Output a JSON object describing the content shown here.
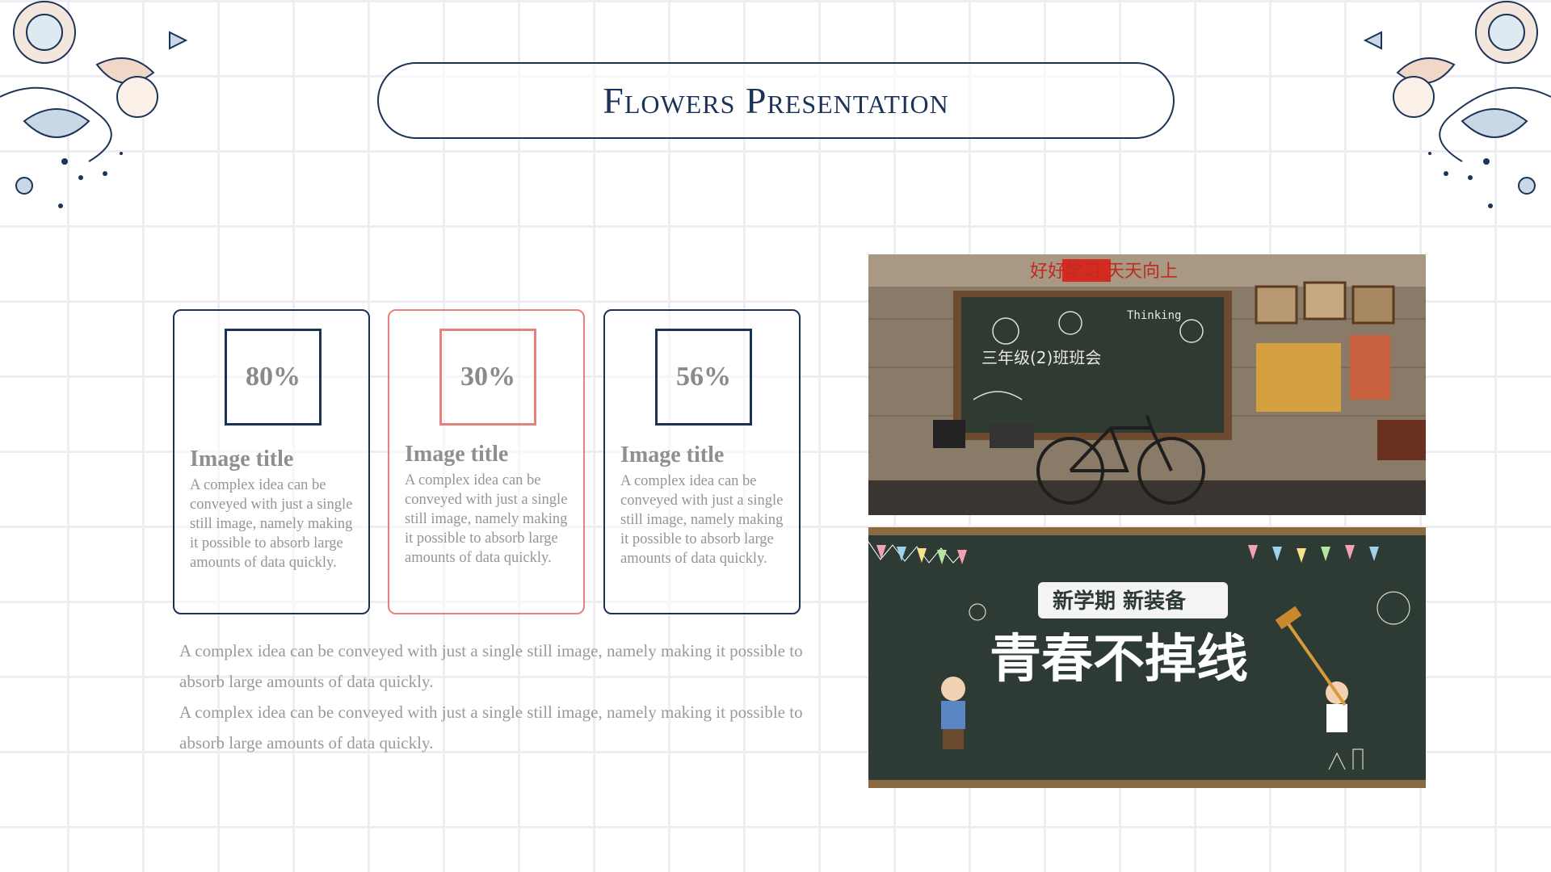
{
  "header": {
    "title": "Flowers Presentation"
  },
  "cards": [
    {
      "percent": "80%",
      "title": "Image title",
      "text": "A complex idea can be conveyed with just a single still image, namely making it possible to absorb large amounts of data quickly.",
      "accent": "#1c3358"
    },
    {
      "percent": "30%",
      "title": "Image title",
      "text": "A complex idea can be conveyed with just a single still image, namely making it possible to absorb large amounts of data quickly.",
      "accent": "#e8807e"
    },
    {
      "percent": "56%",
      "title": "Image title",
      "text": "A complex idea can be conveyed with just a single still image, namely making it possible to absorb large amounts of data quickly.",
      "accent": "#1c3358"
    }
  ],
  "paragraphs": [
    "A complex idea can be conveyed with just a single still image, namely making it possible to absorb large amounts of data quickly.",
    "A complex idea can be conveyed with just a single still image, namely making it possible to absorb large amounts of data quickly."
  ],
  "photos": {
    "top": {
      "banner_text": "好好学习 天天向上",
      "board_text": "三年级(2)班班会",
      "board_note": "Thinking"
    },
    "bottom": {
      "headline": "青春不掉线",
      "subhead": "新学期 新装备"
    }
  },
  "colors": {
    "navy": "#1c3358",
    "coral": "#e8807e",
    "text_gray": "#959595"
  }
}
